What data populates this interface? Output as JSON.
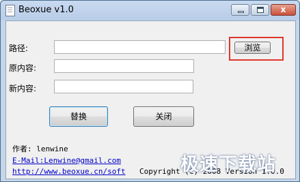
{
  "window": {
    "title": "Beoxue v1.0",
    "controls": {
      "minimize": "minimize",
      "maximize": "maximize",
      "close": "x"
    }
  },
  "form": {
    "path_label": "路径:",
    "path_value": "",
    "browse_label": "浏览",
    "original_label": "原内容:",
    "original_value": "",
    "new_label": "新内容:",
    "new_value": "",
    "replace_label": "替换",
    "close_label": "关闭"
  },
  "footer": {
    "author": "作者: lenwine",
    "email": "E-Mail:Lenwine@gmail.com",
    "website": "http://www.beoxue.cn/soft",
    "copyright": "Copyright (C) 2008 Version 1.0.0"
  },
  "watermark": "极速下载站",
  "colors": {
    "highlight": "#e0352b",
    "link": "#0000c8"
  }
}
